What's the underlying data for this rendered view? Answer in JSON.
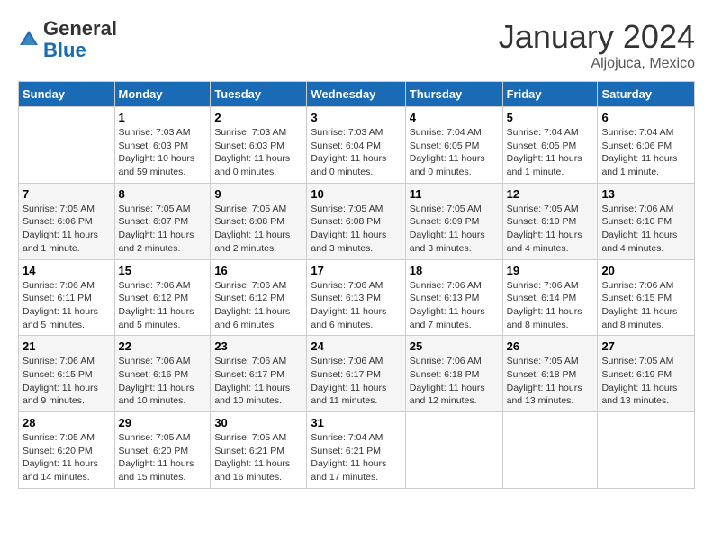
{
  "logo": {
    "general": "General",
    "blue": "Blue"
  },
  "title": "January 2024",
  "location": "Aljojuca, Mexico",
  "days_header": [
    "Sunday",
    "Monday",
    "Tuesday",
    "Wednesday",
    "Thursday",
    "Friday",
    "Saturday"
  ],
  "weeks": [
    [
      {
        "day": "",
        "info": ""
      },
      {
        "day": "1",
        "info": "Sunrise: 7:03 AM\nSunset: 6:03 PM\nDaylight: 10 hours\nand 59 minutes."
      },
      {
        "day": "2",
        "info": "Sunrise: 7:03 AM\nSunset: 6:03 PM\nDaylight: 11 hours\nand 0 minutes."
      },
      {
        "day": "3",
        "info": "Sunrise: 7:03 AM\nSunset: 6:04 PM\nDaylight: 11 hours\nand 0 minutes."
      },
      {
        "day": "4",
        "info": "Sunrise: 7:04 AM\nSunset: 6:05 PM\nDaylight: 11 hours\nand 0 minutes."
      },
      {
        "day": "5",
        "info": "Sunrise: 7:04 AM\nSunset: 6:05 PM\nDaylight: 11 hours\nand 1 minute."
      },
      {
        "day": "6",
        "info": "Sunrise: 7:04 AM\nSunset: 6:06 PM\nDaylight: 11 hours\nand 1 minute."
      }
    ],
    [
      {
        "day": "7",
        "info": "Sunrise: 7:05 AM\nSunset: 6:06 PM\nDaylight: 11 hours\nand 1 minute."
      },
      {
        "day": "8",
        "info": "Sunrise: 7:05 AM\nSunset: 6:07 PM\nDaylight: 11 hours\nand 2 minutes."
      },
      {
        "day": "9",
        "info": "Sunrise: 7:05 AM\nSunset: 6:08 PM\nDaylight: 11 hours\nand 2 minutes."
      },
      {
        "day": "10",
        "info": "Sunrise: 7:05 AM\nSunset: 6:08 PM\nDaylight: 11 hours\nand 3 minutes."
      },
      {
        "day": "11",
        "info": "Sunrise: 7:05 AM\nSunset: 6:09 PM\nDaylight: 11 hours\nand 3 minutes."
      },
      {
        "day": "12",
        "info": "Sunrise: 7:05 AM\nSunset: 6:10 PM\nDaylight: 11 hours\nand 4 minutes."
      },
      {
        "day": "13",
        "info": "Sunrise: 7:06 AM\nSunset: 6:10 PM\nDaylight: 11 hours\nand 4 minutes."
      }
    ],
    [
      {
        "day": "14",
        "info": "Sunrise: 7:06 AM\nSunset: 6:11 PM\nDaylight: 11 hours\nand 5 minutes."
      },
      {
        "day": "15",
        "info": "Sunrise: 7:06 AM\nSunset: 6:12 PM\nDaylight: 11 hours\nand 5 minutes."
      },
      {
        "day": "16",
        "info": "Sunrise: 7:06 AM\nSunset: 6:12 PM\nDaylight: 11 hours\nand 6 minutes."
      },
      {
        "day": "17",
        "info": "Sunrise: 7:06 AM\nSunset: 6:13 PM\nDaylight: 11 hours\nand 6 minutes."
      },
      {
        "day": "18",
        "info": "Sunrise: 7:06 AM\nSunset: 6:13 PM\nDaylight: 11 hours\nand 7 minutes."
      },
      {
        "day": "19",
        "info": "Sunrise: 7:06 AM\nSunset: 6:14 PM\nDaylight: 11 hours\nand 8 minutes."
      },
      {
        "day": "20",
        "info": "Sunrise: 7:06 AM\nSunset: 6:15 PM\nDaylight: 11 hours\nand 8 minutes."
      }
    ],
    [
      {
        "day": "21",
        "info": "Sunrise: 7:06 AM\nSunset: 6:15 PM\nDaylight: 11 hours\nand 9 minutes."
      },
      {
        "day": "22",
        "info": "Sunrise: 7:06 AM\nSunset: 6:16 PM\nDaylight: 11 hours\nand 10 minutes."
      },
      {
        "day": "23",
        "info": "Sunrise: 7:06 AM\nSunset: 6:17 PM\nDaylight: 11 hours\nand 10 minutes."
      },
      {
        "day": "24",
        "info": "Sunrise: 7:06 AM\nSunset: 6:17 PM\nDaylight: 11 hours\nand 11 minutes."
      },
      {
        "day": "25",
        "info": "Sunrise: 7:06 AM\nSunset: 6:18 PM\nDaylight: 11 hours\nand 12 minutes."
      },
      {
        "day": "26",
        "info": "Sunrise: 7:05 AM\nSunset: 6:18 PM\nDaylight: 11 hours\nand 13 minutes."
      },
      {
        "day": "27",
        "info": "Sunrise: 7:05 AM\nSunset: 6:19 PM\nDaylight: 11 hours\nand 13 minutes."
      }
    ],
    [
      {
        "day": "28",
        "info": "Sunrise: 7:05 AM\nSunset: 6:20 PM\nDaylight: 11 hours\nand 14 minutes."
      },
      {
        "day": "29",
        "info": "Sunrise: 7:05 AM\nSunset: 6:20 PM\nDaylight: 11 hours\nand 15 minutes."
      },
      {
        "day": "30",
        "info": "Sunrise: 7:05 AM\nSunset: 6:21 PM\nDaylight: 11 hours\nand 16 minutes."
      },
      {
        "day": "31",
        "info": "Sunrise: 7:04 AM\nSunset: 6:21 PM\nDaylight: 11 hours\nand 17 minutes."
      },
      {
        "day": "",
        "info": ""
      },
      {
        "day": "",
        "info": ""
      },
      {
        "day": "",
        "info": ""
      }
    ]
  ]
}
